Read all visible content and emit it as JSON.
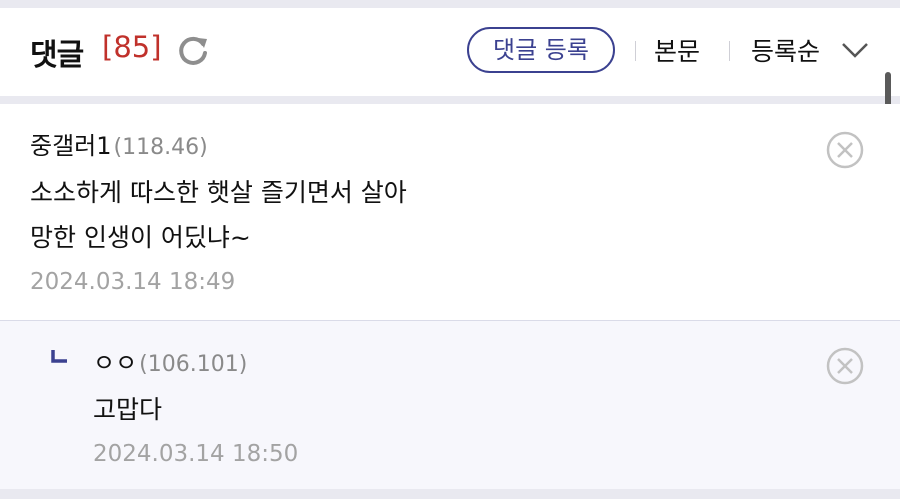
{
  "header": {
    "title": "댓글",
    "count": "[85]",
    "write_button": "댓글 등록",
    "body_link": "본문",
    "sort_label": "등록순"
  },
  "comments": [
    {
      "author": "중갤러1",
      "ip": "(118.46)",
      "lines": [
        "소소하게 따스한 햇살 즐기면서 살아",
        "망한 인생이 어딨냐~"
      ],
      "date": "2024.03.14 18:49"
    },
    {
      "author": "ㅇㅇ",
      "ip": "(106.101)",
      "lines": [
        "고맙다"
      ],
      "date": "2024.03.14 18:50",
      "is_reply": true
    }
  ],
  "icons": {
    "refresh": "refresh-icon",
    "sort_arrow": "chevron-down-icon",
    "delete": "delete-icon",
    "reply": "reply-arrow-icon"
  },
  "colors": {
    "accent": "#3b4190",
    "count": "#c0312b",
    "meta": "#a3a3a3"
  }
}
